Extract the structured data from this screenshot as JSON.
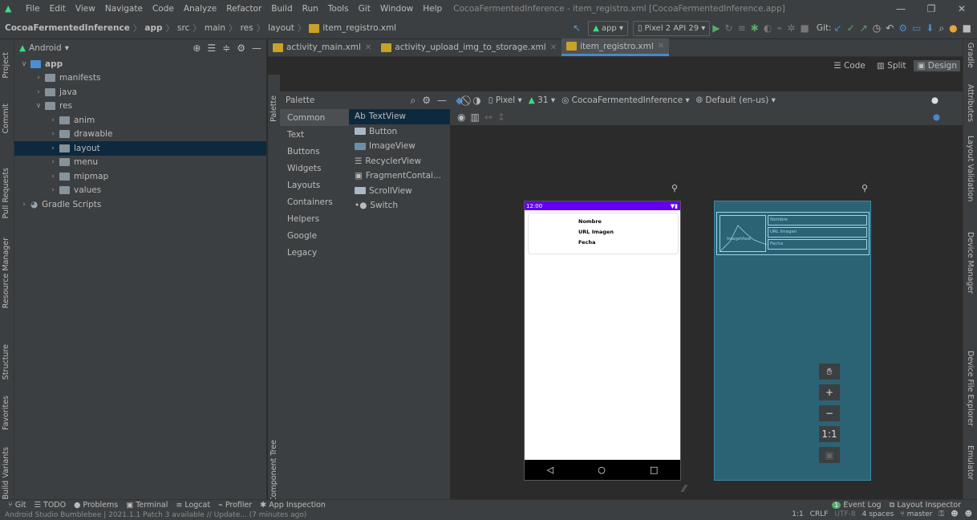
{
  "menubar": {
    "items": [
      "File",
      "Edit",
      "View",
      "Navigate",
      "Code",
      "Analyze",
      "Refactor",
      "Build",
      "Run",
      "Tools",
      "Git",
      "Window",
      "Help"
    ],
    "title": "CocoaFermentedInference - item_registro.xml [CocoaFermentedInference.app]"
  },
  "navbar": {
    "crumbs": [
      "CocoaFermentedInference",
      "app",
      "src",
      "main",
      "res",
      "layout",
      "item_registro.xml"
    ],
    "run_config": "app",
    "device": "Pixel 2 API 29",
    "git_label": "Git:"
  },
  "project": {
    "view_selector": "Android",
    "tree": [
      {
        "label": "app",
        "level": 0,
        "expanded": true,
        "icon": "app-folder-icon"
      },
      {
        "label": "manifests",
        "level": 1,
        "expanded": false,
        "icon": "folder-icon"
      },
      {
        "label": "java",
        "level": 1,
        "expanded": false,
        "icon": "folder-icon"
      },
      {
        "label": "res",
        "level": 1,
        "expanded": true,
        "icon": "res-folder-icon"
      },
      {
        "label": "anim",
        "level": 2,
        "expanded": false,
        "icon": "folder-icon"
      },
      {
        "label": "drawable",
        "level": 2,
        "expanded": false,
        "icon": "folder-icon"
      },
      {
        "label": "layout",
        "level": 2,
        "expanded": false,
        "icon": "folder-icon",
        "selected": true
      },
      {
        "label": "menu",
        "level": 2,
        "expanded": false,
        "icon": "folder-icon"
      },
      {
        "label": "mipmap",
        "level": 2,
        "expanded": false,
        "icon": "folder-icon"
      },
      {
        "label": "values",
        "level": 2,
        "expanded": false,
        "icon": "folder-icon"
      },
      {
        "label": "Gradle Scripts",
        "level": 0,
        "expanded": false,
        "icon": "gradle-icon"
      }
    ]
  },
  "left_tools": [
    "Project",
    "Commit",
    "Pull Requests",
    "Resource Manager",
    "Structure",
    "Favorites",
    "Build Variants"
  ],
  "right_tools": [
    "Gradle",
    "Attributes",
    "Layout Validation",
    "Device Manager",
    "Device File Explorer",
    "Emulator"
  ],
  "tabs": [
    {
      "label": "activity_main.xml",
      "active": false
    },
    {
      "label": "activity_upload_img_to_storage.xml",
      "active": false
    },
    {
      "label": "item_registro.xml",
      "active": true
    }
  ],
  "modes": [
    "Code",
    "Split",
    "Design"
  ],
  "palette": {
    "title": "Palette",
    "strip_label": "Palette",
    "component_tree_label": "Component Tree",
    "categories": [
      "Common",
      "Text",
      "Buttons",
      "Widgets",
      "Layouts",
      "Containers",
      "Helpers",
      "Google",
      "Legacy"
    ],
    "items": [
      "TextView",
      "Button",
      "ImageView",
      "RecyclerView",
      "FragmentContai...",
      "ScrollView",
      "Switch"
    ],
    "item_prefix": "Ab"
  },
  "design_toolbar": {
    "device": "Pixel",
    "api": "31",
    "theme": "CocoaFermentedInference",
    "locale": "Default (en-us)"
  },
  "preview": {
    "time": "12:00",
    "lines": [
      "Nombre",
      "URL Imagen",
      "Fecha"
    ]
  },
  "blueprint": {
    "image_label": "ImageView",
    "lines": [
      "Nombre",
      "URL Imagen",
      "Fecha"
    ]
  },
  "zoom": [
    "+",
    "−",
    "1:1"
  ],
  "bottom_tools": [
    "Git",
    "TODO",
    "Problems",
    "Terminal",
    "Logcat",
    "Profiler",
    "App Inspection"
  ],
  "bottom_right": {
    "event_log": "Event Log",
    "event_count": "1",
    "layout_inspector": "Layout Inspector"
  },
  "status": {
    "message": "Android Studio Bumblebee | 2021.1.1 Patch 3 available // Update... (7 minutes ago)",
    "position": "1:1",
    "line_sep": "CRLF",
    "encoding": "UTF-8",
    "indent": "4 spaces",
    "branch": "master"
  }
}
